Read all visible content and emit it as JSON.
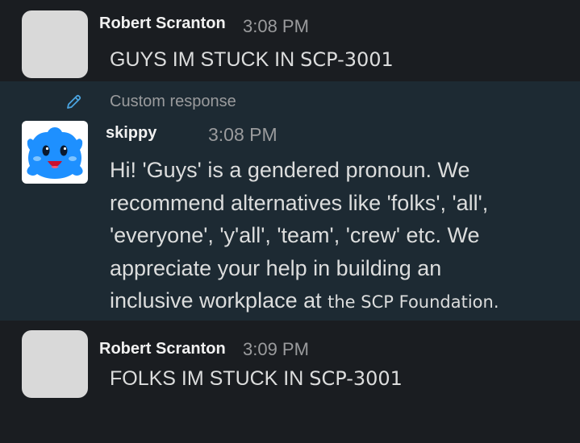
{
  "messages": [
    {
      "author": "Robert Scranton",
      "time": "3:08 PM",
      "text_main": "GUYS IM STUCK IN",
      "text_tail": "SCP-3001"
    },
    {
      "label": "Custom response",
      "author": "skippy",
      "time": "3:08 PM",
      "lines": [
        "Hi! 'Guys' is a gendered pronoun. We",
        "recommend alternatives like 'folks', 'all',",
        "'everyone', 'y'all', 'team', 'crew' etc. We",
        "appreciate your help in building an",
        "inclusive workplace at"
      ],
      "line_tail": "the SCP Foundation."
    },
    {
      "author": "Robert Scranton",
      "time": "3:09 PM",
      "text_main": "FOLKS IM STUCK IN",
      "text_tail": "SCP-3001"
    }
  ],
  "colors": {
    "background": "#1a1d21",
    "highlight": "#1d2a33",
    "bot_avatar": "#1e90ff"
  },
  "icons": {
    "edit": "pencil-icon",
    "bot_avatar": "blue-mascot-icon"
  }
}
